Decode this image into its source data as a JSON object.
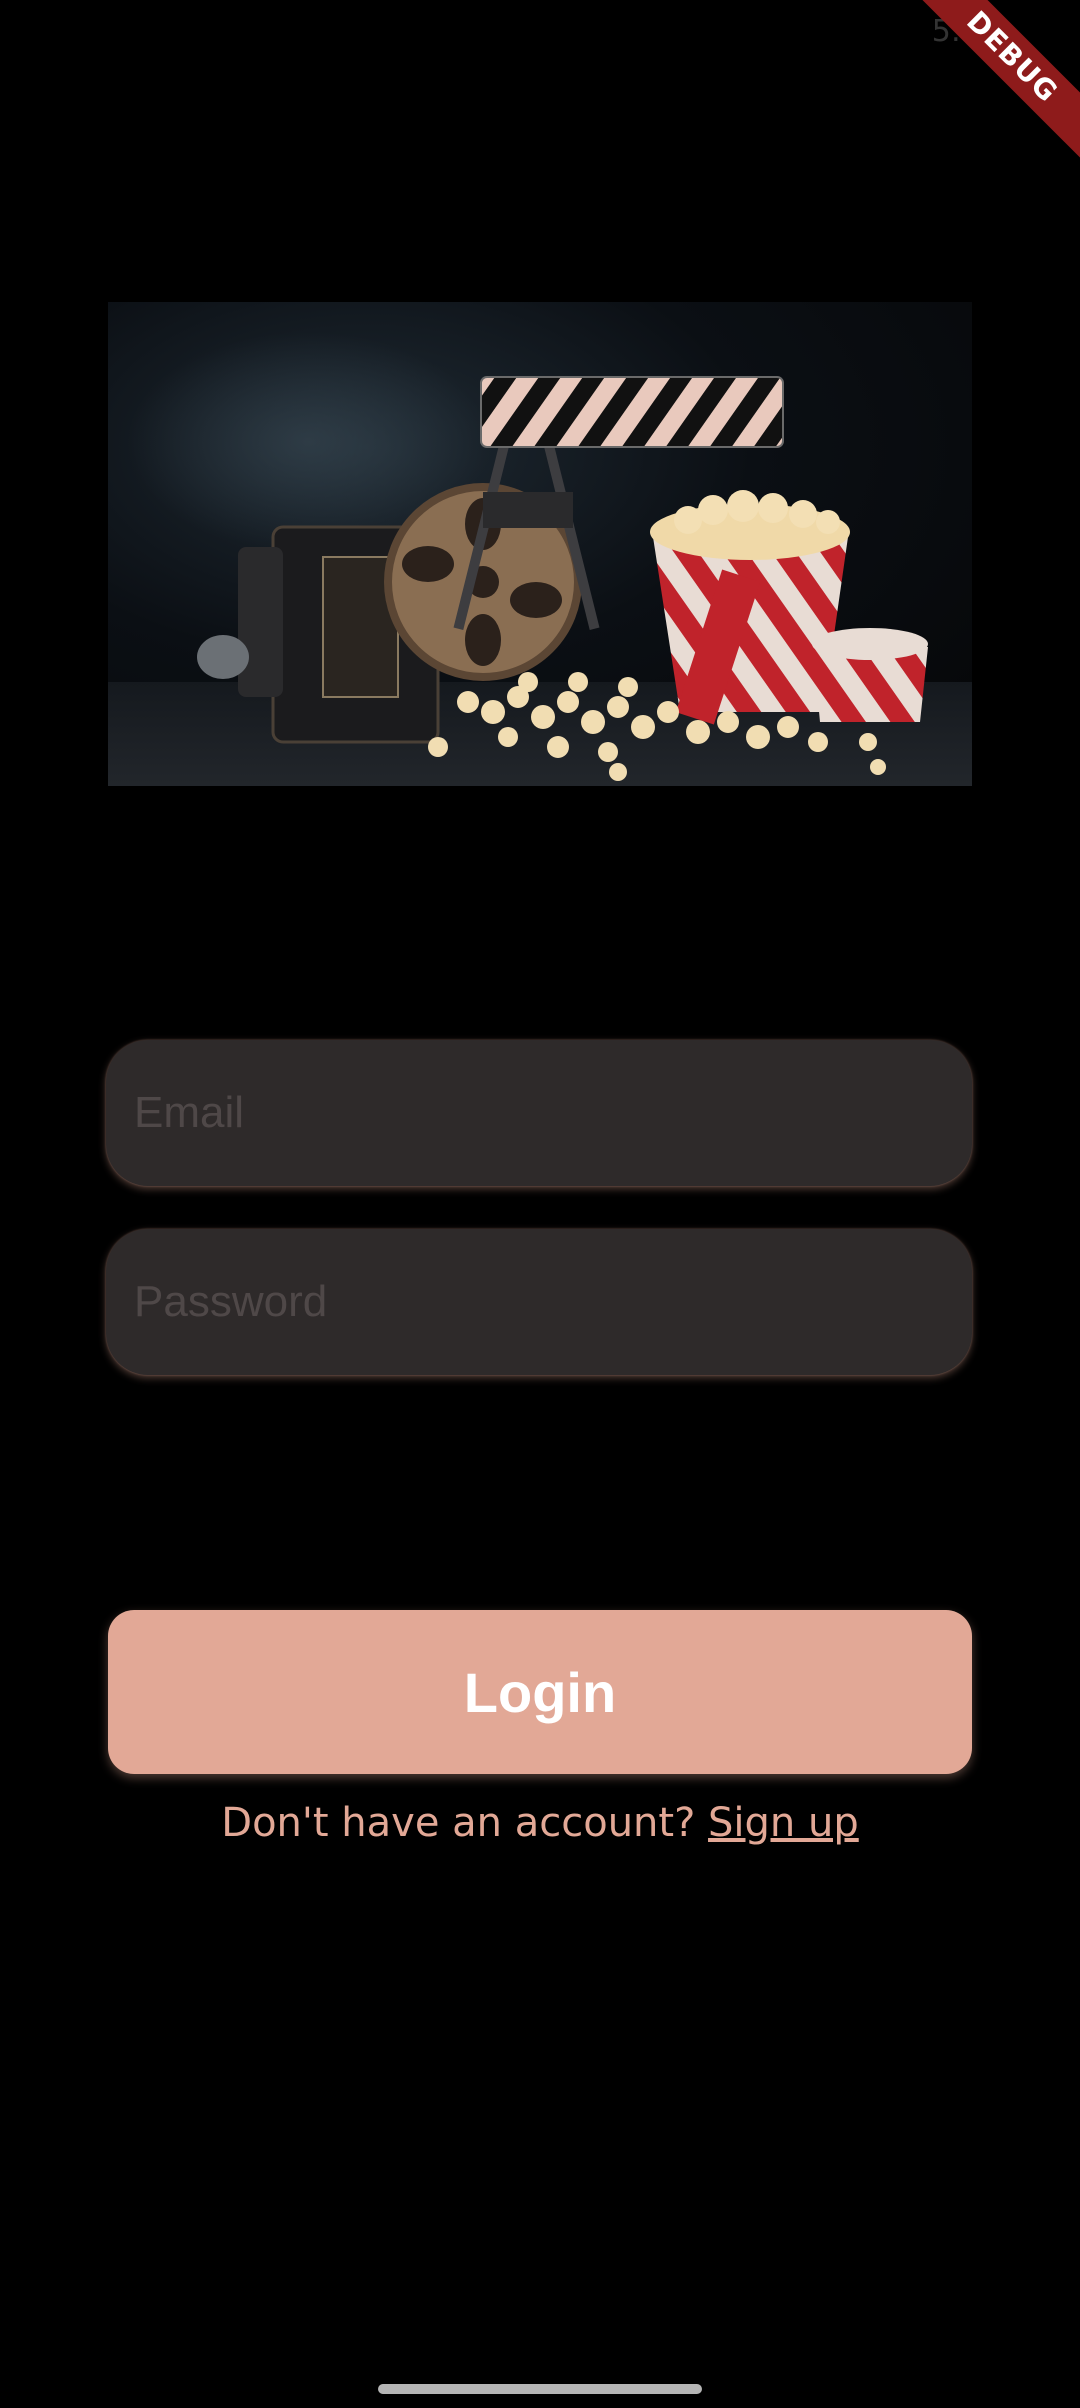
{
  "status_bar": {
    "time": "5:5"
  },
  "debug_banner": {
    "label": "DEBUG"
  },
  "hero": {
    "icon": "cinema-popcorn-film-illustration"
  },
  "login_form": {
    "email_placeholder": "Email",
    "password_placeholder": "Password",
    "login_label": "Login"
  },
  "signup": {
    "prompt": "Don't have an account? ",
    "link_label": "Sign up"
  },
  "colors": {
    "accent": "#e2a896",
    "background": "#000000",
    "field_background": "#2e2a2a",
    "debug_banner": "#8e1b1b"
  }
}
